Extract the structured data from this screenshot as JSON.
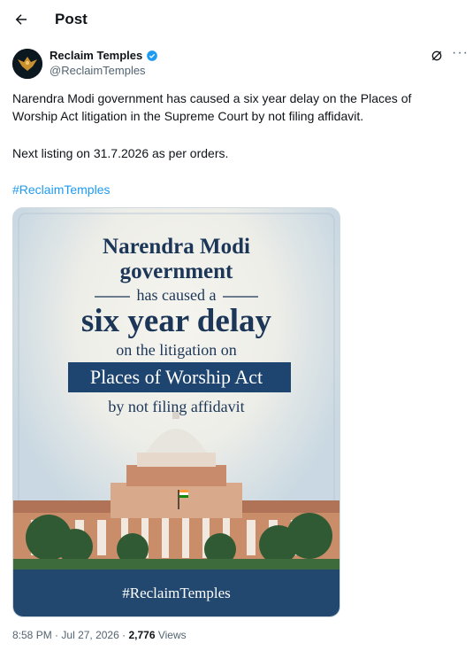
{
  "header": {
    "title": "Post"
  },
  "author": {
    "name": "Reclaim Temples",
    "handle": "@ReclaimTemples"
  },
  "post": {
    "line1": "Narendra Modi government has caused a six year delay on the Places of",
    "line2": "Worship Act litigation in the Supreme Court by not filing affidavit.",
    "line3": "Next listing on 31.7.2026 as per orders.",
    "hashtag": "#ReclaimTemples"
  },
  "image": {
    "t1": "Narendra Modi",
    "t2": "government",
    "t3": "has caused a",
    "t4": "six year delay",
    "t5": "on the litigation on",
    "t6": "Places of Worship Act",
    "t7": "by not filing affidavit",
    "footer": "#ReclaimTemples"
  },
  "meta": {
    "time": "8:58 PM",
    "date": "Jul 27, 2026",
    "views_count": "2,776",
    "views_label": "Views",
    "sep": "·"
  },
  "colors": {
    "accent": "#1d9bf0",
    "navy": "#234870",
    "verified": "#1d9bf0"
  },
  "icons": [
    "back-arrow-icon",
    "verified-badge-icon",
    "grok-icon",
    "more-icon"
  ]
}
